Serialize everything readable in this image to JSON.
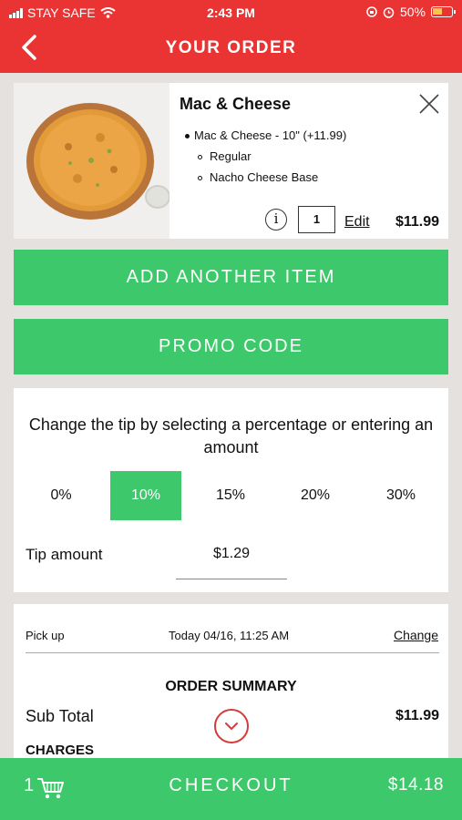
{
  "status_bar": {
    "carrier": "STAY SAFE",
    "time": "2:43 PM",
    "battery": "50%"
  },
  "header": {
    "title": "YOUR ORDER",
    "back_icon": "chevron-left-icon",
    "background": "#ea3434"
  },
  "order_item": {
    "name": "Mac & Cheese",
    "option_main": "Mac & Cheese - 10\" (+11.99)",
    "option_size": "Regular",
    "option_base": "Nacho Cheese Base",
    "info_icon": "i",
    "quantity": "1",
    "edit_label": "Edit",
    "price": "$11.99"
  },
  "buttons": {
    "add_item": "ADD ANOTHER ITEM",
    "promo": "PROMO CODE",
    "accent": "#3dc96b"
  },
  "tip": {
    "instruction": "Change the tip by selecting a percentage or entering an amount",
    "options": [
      "0%",
      "10%",
      "15%",
      "20%",
      "30%"
    ],
    "selected": "10%",
    "amount_label": "Tip amount",
    "amount_value": "$1.29"
  },
  "summary": {
    "pickup_label": "Pick up",
    "pickup_time": "Today 04/16, 11:25 AM",
    "change_label": "Change",
    "title": "ORDER SUMMARY",
    "subtotal_label": "Sub Total",
    "subtotal_value": "$11.99",
    "charges_label": "CHARGES"
  },
  "checkout": {
    "cart_count": "1",
    "label": "CHECKOUT",
    "total": "$14.18"
  }
}
